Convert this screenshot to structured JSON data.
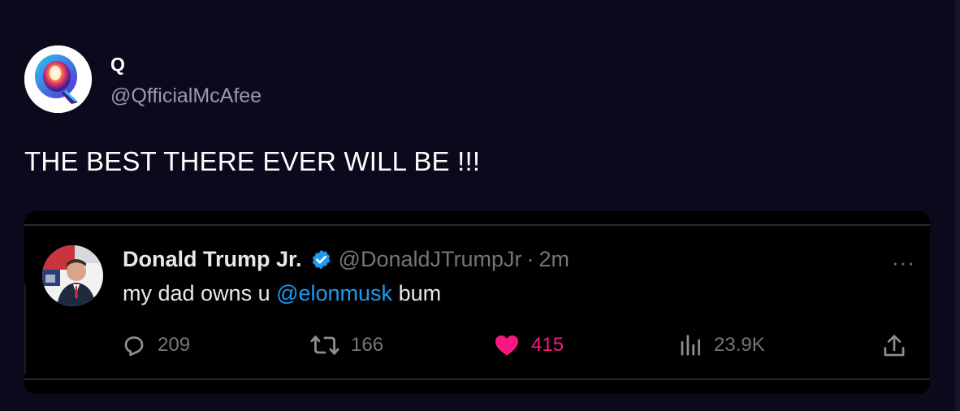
{
  "post": {
    "author_name": "Q",
    "author_handle": "@QfficialMcAfee",
    "text": "THE BEST THERE EVER WILL BE !!!"
  },
  "embedded_tweet": {
    "author_name": "Donald Trump Jr.",
    "handle": "@DonaldJTrumpJr",
    "separator": "·",
    "time": "2m",
    "more": "···",
    "text_before": "my dad owns u ",
    "mention": "@elonmusk",
    "text_after": " bum",
    "actions": {
      "replies": "209",
      "retweets": "166",
      "likes": "415",
      "views": "23.9K"
    },
    "verified": true
  },
  "colors": {
    "background": "#0b0a1c",
    "embed_background": "#000000",
    "muted": "#71767b",
    "mention": "#1d9bf0",
    "like": "#f91880",
    "verified": "#1d9bf0"
  },
  "icons": [
    "q-logo-avatar",
    "profile-photo-avatar",
    "verified-badge-icon",
    "more-icon",
    "reply-icon",
    "retweet-icon",
    "like-heart-icon",
    "views-chart-icon",
    "share-icon"
  ]
}
